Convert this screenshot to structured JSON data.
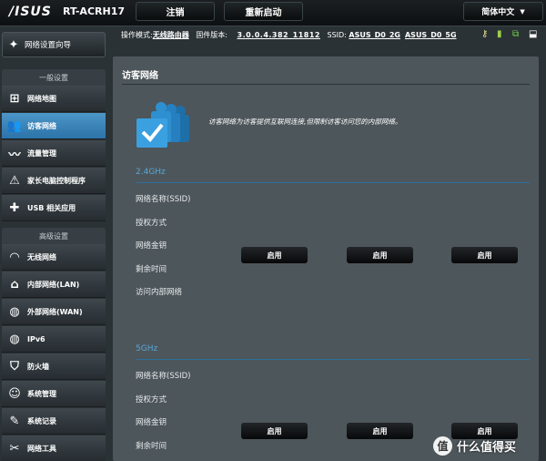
{
  "header": {
    "logo": "/ISUS",
    "model": "RT-ACRH17",
    "logout_label": "注销",
    "reboot_label": "重新启动",
    "language": "简体中文"
  },
  "status": {
    "mode_label": "操作模式:",
    "mode_value": "无线路由器",
    "fw_label": "固件版本:",
    "fw_value": "3.0.0.4.382_11812",
    "ssid_label": "SSID:",
    "ssid_2g": "ASUS_D0_2G",
    "ssid_5g": "ASUS_D0_5G"
  },
  "sidebar": {
    "quick_setup": "网络设置向导",
    "general_header": "一般设置",
    "general_items": [
      {
        "label": "网络地图",
        "icon": "network-map-icon",
        "glyph": "⊞"
      },
      {
        "label": "访客网络",
        "icon": "guest-network-icon",
        "glyph": "👥",
        "active": true
      },
      {
        "label": "流量管理",
        "icon": "traffic-icon",
        "glyph": "〰"
      },
      {
        "label": "家长电脑控制程序",
        "icon": "parental-control-icon",
        "glyph": "⚠"
      },
      {
        "label": "USB 相关应用",
        "icon": "puzzle-icon",
        "glyph": "✚"
      }
    ],
    "advanced_header": "高级设置",
    "advanced_items": [
      {
        "label": "无线网络",
        "icon": "wifi-icon",
        "glyph": "◠"
      },
      {
        "label": "内部网络(LAN)",
        "icon": "home-icon",
        "glyph": "⌂"
      },
      {
        "label": "外部网络(WAN)",
        "icon": "globe-icon",
        "glyph": "◍"
      },
      {
        "label": "IPv6",
        "icon": "ipv6-globe-icon",
        "glyph": "◍"
      },
      {
        "label": "防火墙",
        "icon": "shield-icon",
        "glyph": "⛉"
      },
      {
        "label": "系统管理",
        "icon": "admin-icon",
        "glyph": "☺"
      },
      {
        "label": "系统记录",
        "icon": "log-icon",
        "glyph": "✎"
      },
      {
        "label": "网络工具",
        "icon": "tools-icon",
        "glyph": "✂"
      }
    ]
  },
  "main": {
    "title": "访客网络",
    "description": "访客网络为访客提供互联网连接,但限制访客访问您的内部网络。",
    "band_24": {
      "name": "2.4GHz",
      "fields": [
        "网络名称(SSID)",
        "授权方式",
        "网络金钥",
        "剩余时间",
        "访问内部网络"
      ],
      "buttons": [
        "启用",
        "启用",
        "启用"
      ]
    },
    "band_5": {
      "name": "5GHz",
      "fields": [
        "网络名称(SSID)",
        "授权方式",
        "网络金钥",
        "剩余时间"
      ],
      "buttons": [
        "启用",
        "启用",
        "启用"
      ]
    }
  },
  "watermark": {
    "circle": "值",
    "text": "什么值得买"
  },
  "colors": {
    "accent": "#59a6d8",
    "active_nav": "#3d86bb",
    "panel": "#4d565b",
    "background": "#2b3236"
  }
}
